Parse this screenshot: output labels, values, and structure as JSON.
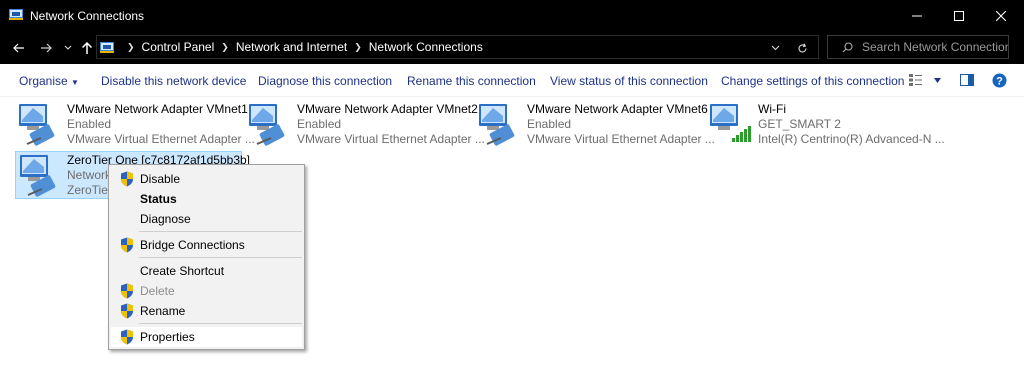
{
  "window": {
    "title": "Network Connections",
    "icon": "network-folder-icon"
  },
  "address": {
    "crumbs": [
      "Control Panel",
      "Network and Internet",
      "Network Connections"
    ],
    "search_placeholder": "Search Network Connections"
  },
  "commands": {
    "organise": "Organise",
    "disable": "Disable this network device",
    "diagnose": "Diagnose this connection",
    "rename": "Rename this connection",
    "view_status": "View status of this connection",
    "change_settings": "Change settings of this connection"
  },
  "connections": [
    {
      "name": "VMware Network Adapter VMnet1",
      "status": "Enabled",
      "device": "VMware Virtual Ethernet Adapter ...",
      "icon": "ethernet-adapter-icon"
    },
    {
      "name": "VMware Network Adapter VMnet2",
      "status": "Enabled",
      "device": "VMware Virtual Ethernet Adapter ...",
      "icon": "ethernet-adapter-icon"
    },
    {
      "name": "VMware Network Adapter VMnet6",
      "status": "Enabled",
      "device": "VMware Virtual Ethernet Adapter ...",
      "icon": "ethernet-adapter-icon"
    },
    {
      "name": "Wi-Fi",
      "status": "GET_SMART 2",
      "device": "Intel(R) Centrino(R) Advanced-N ...",
      "icon": "wifi-adapter-icon"
    },
    {
      "name": "ZeroTier One [c7c8172af1d5bb3b]",
      "status": "Network",
      "device": "ZeroTier",
      "icon": "ethernet-adapter-icon",
      "selected": true
    }
  ],
  "context_menu": {
    "disable": "Disable",
    "status": "Status",
    "diagnose": "Diagnose",
    "bridge": "Bridge Connections",
    "create_shortcut": "Create Shortcut",
    "delete": "Delete",
    "rename": "Rename",
    "properties": "Properties"
  },
  "colors": {
    "titlebar": "#000000",
    "command_text": "#1e3287",
    "selection": "#cce8ff",
    "menu_bg": "#f2f2f2",
    "help": "#1565c0"
  }
}
